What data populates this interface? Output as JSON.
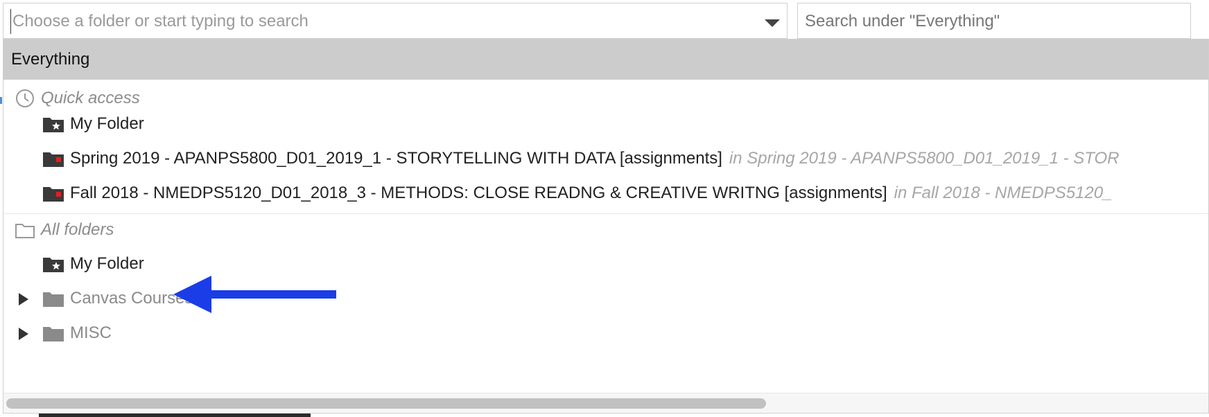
{
  "folder_picker": {
    "placeholder": "Choose a folder or start typing to search"
  },
  "search_scope": {
    "placeholder": "Search under \"Everything\""
  },
  "dropdown": {
    "selected_scope": "Everything",
    "quick_access": {
      "header": "Quick access",
      "items": [
        {
          "label": "My Folder",
          "path": ""
        },
        {
          "label": "Spring 2019 - APANPS5800_D01_2019_1 - STORYTELLING WITH DATA [assignments]",
          "path": "in Spring 2019 - APANPS5800_D01_2019_1 - STOR"
        },
        {
          "label": "Fall 2018 - NMEDPS5120_D01_2018_3 - METHODS: CLOSE READNG & CREATIVE WRITNG [assignments]",
          "path": "in Fall 2018 - NMEDPS5120_"
        }
      ]
    },
    "all_folders": {
      "header": "All folders",
      "items": [
        {
          "label": "My Folder"
        },
        {
          "label": "Canvas Courses"
        },
        {
          "label": "MISC"
        }
      ]
    }
  },
  "colors": {
    "annotation_arrow": "#1a3de8",
    "selected_row_bg": "#cccccc",
    "dim_text": "#8c8c8c"
  }
}
